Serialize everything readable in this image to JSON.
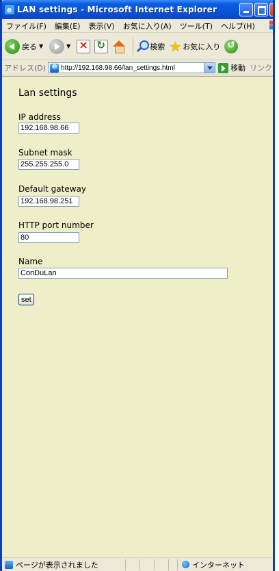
{
  "window": {
    "title": "LAN settings - Microsoft Internet Explorer"
  },
  "menu": {
    "items": [
      "ファイル(F)",
      "編集(E)",
      "表示(V)",
      "お気に入り(A)",
      "ツール(T)",
      "ヘルプ(H)"
    ]
  },
  "toolbar": {
    "back_label": "戻る",
    "search_label": "検索",
    "favorites_label": "お気に入り"
  },
  "address": {
    "label": "アドレス(D)",
    "url": "http://192.168.98.66/lan_settings.html",
    "go_label": "移動",
    "links_label": "リンク"
  },
  "page": {
    "heading": "Lan settings",
    "fields": [
      {
        "label": "IP address",
        "value": "192.168.98.66"
      },
      {
        "label": "Subnet mask",
        "value": "255.255.255.0"
      },
      {
        "label": "Default gateway",
        "value": "192.168.98.251"
      },
      {
        "label": "HTTP port number",
        "value": "80"
      },
      {
        "label": "Name",
        "value": "ConDuLan"
      }
    ],
    "submit_label": "set",
    "background_color": "#eeeec9"
  },
  "status": {
    "text": "ページが表示されました",
    "zone": "インターネット"
  }
}
